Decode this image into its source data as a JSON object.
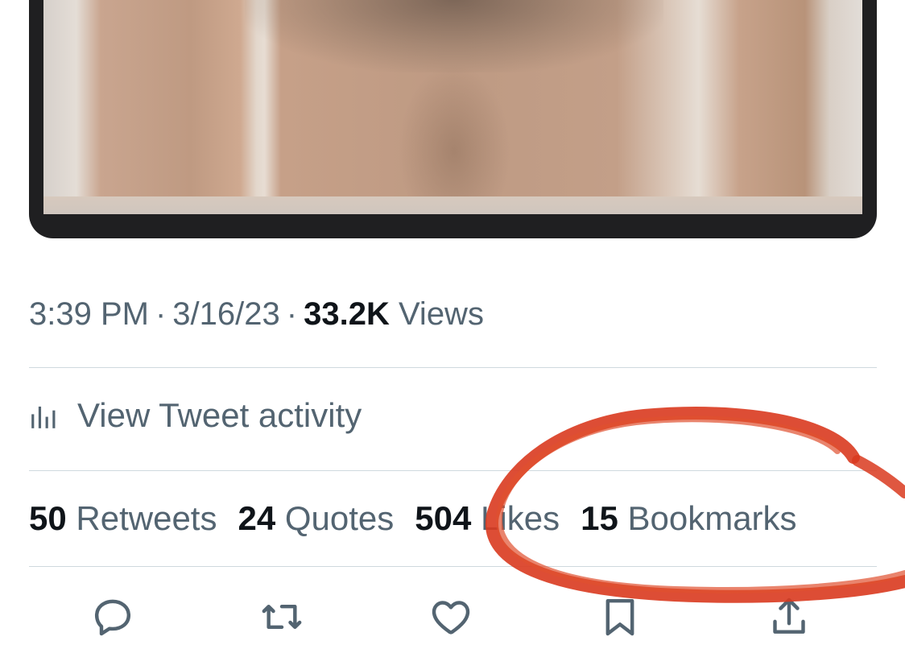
{
  "tweet": {
    "time": "3:39 PM",
    "date": "3/16/23",
    "views_count": "33.2K",
    "views_label": "Views",
    "separator": "·"
  },
  "activity": {
    "label": "View Tweet activity",
    "icon": "bar-chart-icon"
  },
  "stats": [
    {
      "count": "50",
      "label": "Retweets"
    },
    {
      "count": "24",
      "label": "Quotes"
    },
    {
      "count": "504",
      "label": "Likes"
    },
    {
      "count": "15",
      "label": "Bookmarks"
    }
  ],
  "actions": [
    {
      "name": "reply",
      "icon": "reply-icon"
    },
    {
      "name": "retweet",
      "icon": "retweet-icon"
    },
    {
      "name": "like",
      "icon": "heart-icon"
    },
    {
      "name": "bookmark",
      "icon": "bookmark-icon"
    },
    {
      "name": "share",
      "icon": "share-icon"
    }
  ],
  "colors": {
    "primary_text": "#0f1419",
    "secondary_text": "#536471",
    "divider": "#cfd9de",
    "annotation": "#d93a1f"
  }
}
